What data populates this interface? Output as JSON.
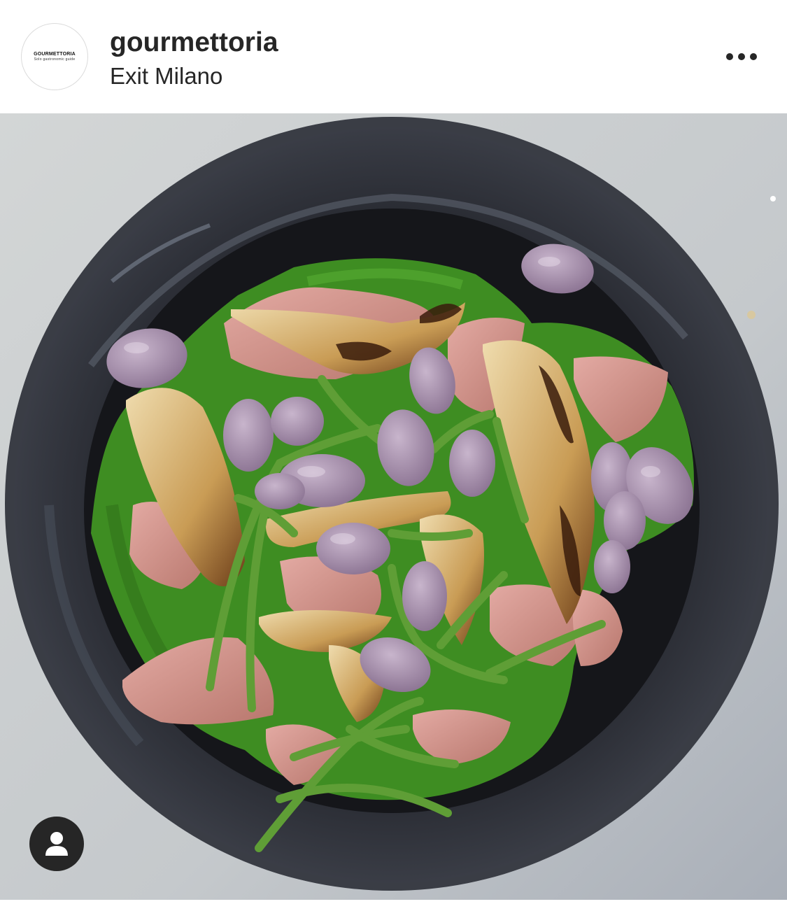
{
  "post": {
    "account": {
      "username": "gourmettoria",
      "avatar_brand": "GOURMETTORIA",
      "avatar_tagline": "Solo gastronomic guide"
    },
    "location": "Exit Milano",
    "more_icon": "more-horizontal-icon",
    "tag_icon": "user-tag-icon",
    "photo": {
      "subject": "food-photo"
    }
  },
  "colors": {
    "header_bg": "#ffffff",
    "text": "#262626",
    "avatar_border": "#dbdbdb",
    "tag_button_bg": "#262626",
    "table": "#c9cdd0",
    "bowl": "#2a2c33",
    "green_sauce": "#3d8a22",
    "meat": "#d49a92",
    "bean": "#a08aa6",
    "samphire": "#5b9a35",
    "onion": "#d6b679"
  }
}
